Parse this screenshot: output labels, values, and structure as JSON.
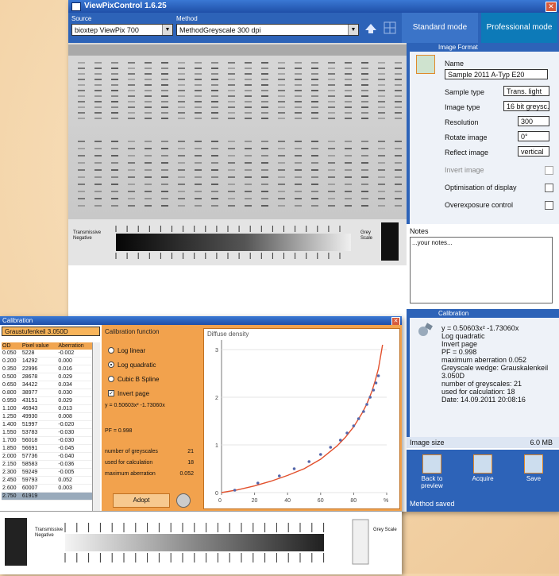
{
  "app": {
    "title": "ViewPixControl 1.6.25",
    "close_symbol": "✕"
  },
  "toolbar": {
    "source_label": "Source",
    "source_value": "bioxtep ViewPix 700",
    "method_label": "Method",
    "method_value": "MethodGreyscale 300 dpi",
    "mode_standard": "Standard mode",
    "mode_professional": "Professional mode"
  },
  "gel_scale": {
    "left_label": "Transmissive Negative",
    "right_label": "Grey Scale"
  },
  "image_format": {
    "header": "Image Format",
    "name_label": "Name",
    "name_value": "Sample 2011 A-Typ E20",
    "fields": [
      {
        "label": "Sample type",
        "value": "Trans. light"
      },
      {
        "label": "Image type",
        "value": "16 bit greysc."
      },
      {
        "label": "Resolution",
        "value": "300"
      },
      {
        "label": "Rotate image",
        "value": "0°"
      },
      {
        "label": "Reflect image",
        "value": "vertical"
      }
    ],
    "checks": [
      {
        "label": "Invert image",
        "checked": false,
        "disabled": true
      },
      {
        "label": "Optimisation of display",
        "checked": false,
        "disabled": false
      },
      {
        "label": "Overexposure control",
        "checked": false,
        "disabled": false
      }
    ]
  },
  "notes": {
    "label": "Notes",
    "value": "...your notes..."
  },
  "calibration_panel": {
    "header": "Calibration",
    "lines": [
      "y = 0.50603x² -1.73060x",
      "Log quadratic",
      "Invert page",
      "PF = 0.998",
      "maximum aberration 0.052",
      "Greyscale wedge: Grauskalenkeil",
      "3.050D",
      "number of greyscales: 21",
      "used for calculation: 18",
      "Date: 14.09.2011 20:08:16"
    ]
  },
  "image_size": {
    "label": "Image size",
    "value": "6.0 MB"
  },
  "actions": [
    {
      "label": "Back to preview"
    },
    {
      "label": "Acquire"
    },
    {
      "label": "Save"
    }
  ],
  "status": "Method saved",
  "calibration_window": {
    "title": "Calibration",
    "combo_value": "Graustufenkeil 3.050D",
    "table_headers": [
      "OD",
      "Pixel value",
      "Aberration"
    ],
    "table_rows": [
      [
        "0.050",
        "5228",
        "-0.002"
      ],
      [
        "0.200",
        "14292",
        "0.000"
      ],
      [
        "0.350",
        "22996",
        "0.016"
      ],
      [
        "0.500",
        "28678",
        "0.029"
      ],
      [
        "0.650",
        "34422",
        "0.034"
      ],
      [
        "0.800",
        "38977",
        "0.030"
      ],
      [
        "0.950",
        "43151",
        "0.029"
      ],
      [
        "1.100",
        "46943",
        "0.013"
      ],
      [
        "1.250",
        "49930",
        "0.008"
      ],
      [
        "1.400",
        "51997",
        "-0.020"
      ],
      [
        "1.550",
        "53783",
        "-0.030"
      ],
      [
        "1.700",
        "56018",
        "-0.030"
      ],
      [
        "1.850",
        "56691",
        "-0.045"
      ],
      [
        "2.000",
        "57736",
        "-0.040"
      ],
      [
        "2.150",
        "58583",
        "-0.036"
      ],
      [
        "2.300",
        "59249",
        "-0.005"
      ],
      [
        "2.450",
        "59793",
        "0.052"
      ],
      [
        "2.600",
        "60007",
        "0.003"
      ],
      [
        "2.750",
        "61919",
        ""
      ]
    ],
    "function_header": "Calibration function",
    "options": [
      {
        "label": "Log linear",
        "selected": false
      },
      {
        "label": "Log quadratic",
        "selected": true
      },
      {
        "label": "Cubic B Spline",
        "selected": false
      }
    ],
    "invert_label": "Invert page",
    "formula": "y = 0.50603x² -1.73060x",
    "pf": "PF = 0.998",
    "metrics": [
      {
        "label": "number of greyscales",
        "value": "21"
      },
      {
        "label": "used for calculation",
        "value": "18"
      },
      {
        "label": "maximum aberration",
        "value": "0.052"
      }
    ],
    "adopt_label": "Adopt",
    "graph_title": "Diffuse density",
    "bottom_left_label": "Transmissive Negative",
    "bottom_right_label": "Grey Scale"
  },
  "chart_data": {
    "type": "scatter",
    "title": "Diffuse density",
    "xlabel": "",
    "ylabel": "",
    "x_ticks": [
      "0",
      "20",
      "40",
      "60",
      "80",
      "%"
    ],
    "y_ticks": [
      "0",
      "1",
      "2",
      "3"
    ],
    "xlim": [
      0,
      100
    ],
    "ylim": [
      0,
      3.2
    ],
    "points_x": [
      8,
      22,
      35,
      44,
      53,
      60,
      66,
      72,
      76,
      80,
      83,
      86,
      88,
      90,
      92,
      93.5,
      95
    ],
    "points_y": [
      0.05,
      0.2,
      0.35,
      0.5,
      0.65,
      0.8,
      0.95,
      1.1,
      1.25,
      1.4,
      1.55,
      1.7,
      1.85,
      2.0,
      2.15,
      2.3,
      2.45
    ],
    "fit_x": [
      0,
      10,
      20,
      30,
      40,
      50,
      60,
      70,
      75,
      80,
      85,
      88,
      91,
      93,
      95,
      96,
      97.5
    ],
    "fit_y": [
      0,
      0.06,
      0.14,
      0.24,
      0.36,
      0.5,
      0.7,
      0.98,
      1.16,
      1.38,
      1.66,
      1.86,
      2.12,
      2.34,
      2.6,
      2.8,
      3.1
    ],
    "colors": {
      "points": "#5566aa",
      "curve": "#e2502c"
    }
  }
}
